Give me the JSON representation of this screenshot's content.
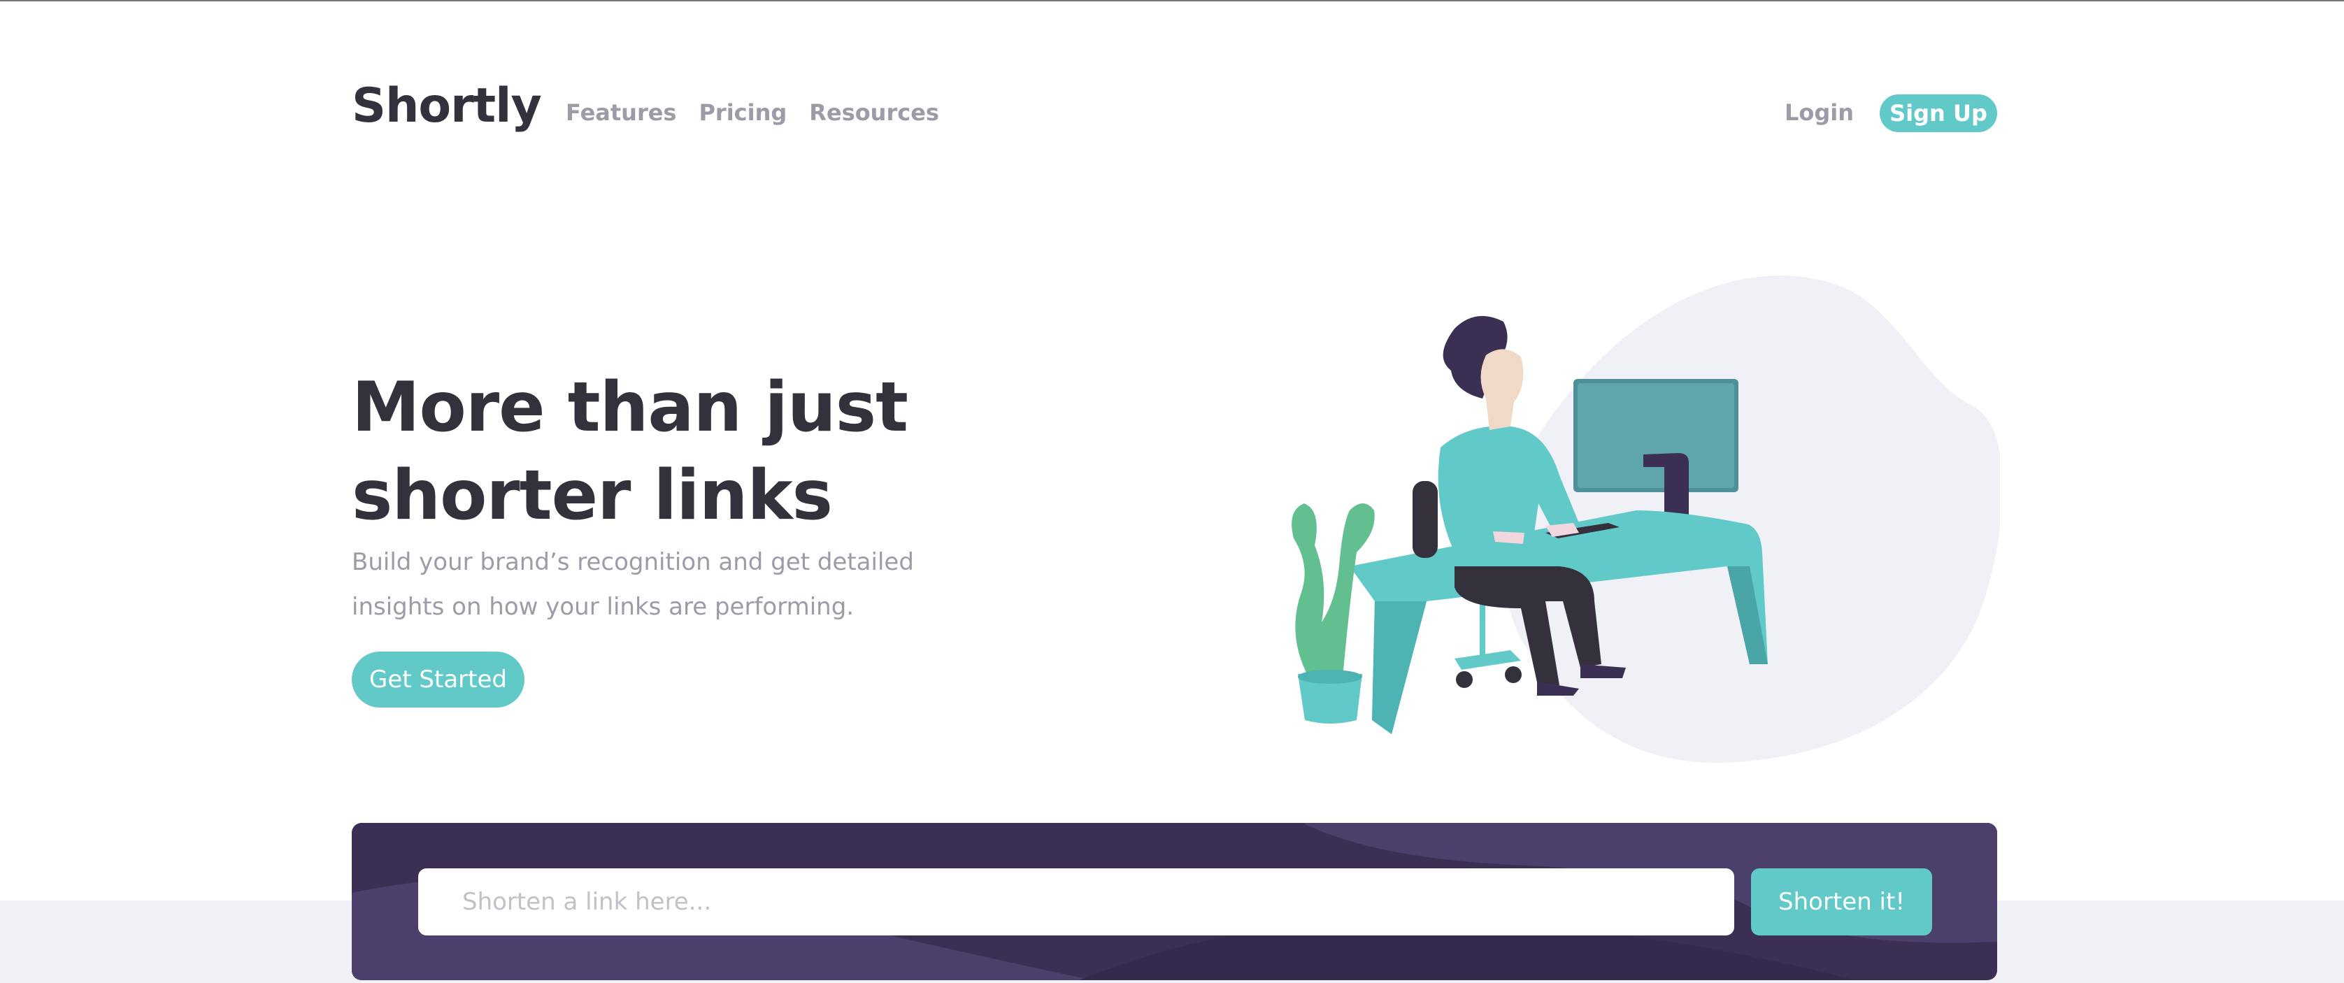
{
  "header": {
    "logo": "Shortly",
    "nav": [
      {
        "label": "Features"
      },
      {
        "label": "Pricing"
      },
      {
        "label": "Resources"
      }
    ],
    "login_label": "Login",
    "signup_label": "Sign Up"
  },
  "hero": {
    "title": "More than just shorter links",
    "description": "Build your brand’s recognition and get detailed insights on how your links are performing.",
    "cta_label": "Get Started",
    "illustration": "person-working-at-desk-illustration"
  },
  "shorten": {
    "placeholder": "Shorten a link here...",
    "value": "",
    "button_label": "Shorten it!"
  },
  "colors": {
    "accent": "#62c9c9",
    "dark_violet": "#3b3054",
    "heading": "#34313d",
    "muted": "#9e9aa8",
    "band": "#f0f1f6"
  }
}
